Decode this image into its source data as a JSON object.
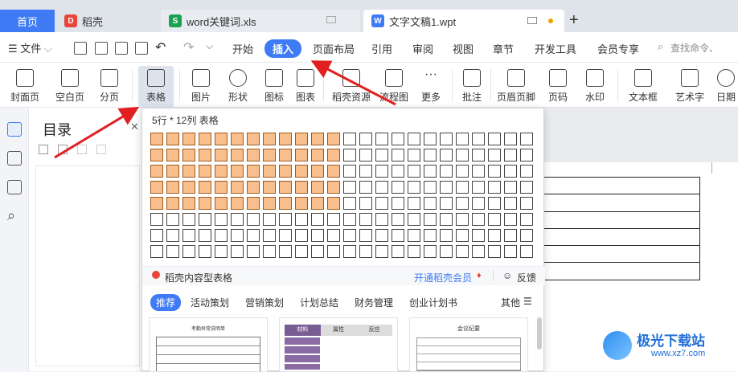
{
  "tabs": {
    "home": "首页",
    "daoke": "稻壳",
    "xls": "word关键词.xls",
    "doc": "文字文稿1.wpt",
    "add": "+"
  },
  "menu": {
    "file": "文件",
    "items": [
      "开始",
      "插入",
      "页面布局",
      "引用",
      "审阅",
      "视图",
      "章节",
      "开发工具",
      "会员专享"
    ],
    "active_index": 1,
    "search": "查找命令、"
  },
  "ribbon": [
    "封面页",
    "空白页",
    "分页",
    "表格",
    "图片",
    "形状",
    "图标",
    "图表",
    "稻壳资源",
    "流程图",
    "更多",
    "批注",
    "页眉页脚",
    "页码",
    "水印",
    "文本框",
    "艺术字",
    "日期"
  ],
  "toc": {
    "title": "目录"
  },
  "table_popup": {
    "size_label": "5行 * 12列 表格",
    "rows": 8,
    "cols": 24,
    "selected_rows": 5,
    "selected_cols": 12,
    "content_tables": "稻壳内容型表格",
    "member": "开通稻壳会员",
    "feedback": "反馈",
    "categories": [
      "推荐",
      "活动策划",
      "营销策划",
      "计划总结",
      "财务管理",
      "创业计划书"
    ],
    "more": "其他",
    "thumb1_title": "考勤异常说明单",
    "thumb2_headers": [
      "材料",
      "属性",
      "反应"
    ],
    "thumb3_title": "会议纪要"
  },
  "watermark": {
    "name": "极光下载站",
    "url": "www.xz7.com"
  },
  "colors": {
    "accent": "#3e7bf5",
    "selected_cell": "#f8bf8d",
    "arrow": "#e02020"
  }
}
